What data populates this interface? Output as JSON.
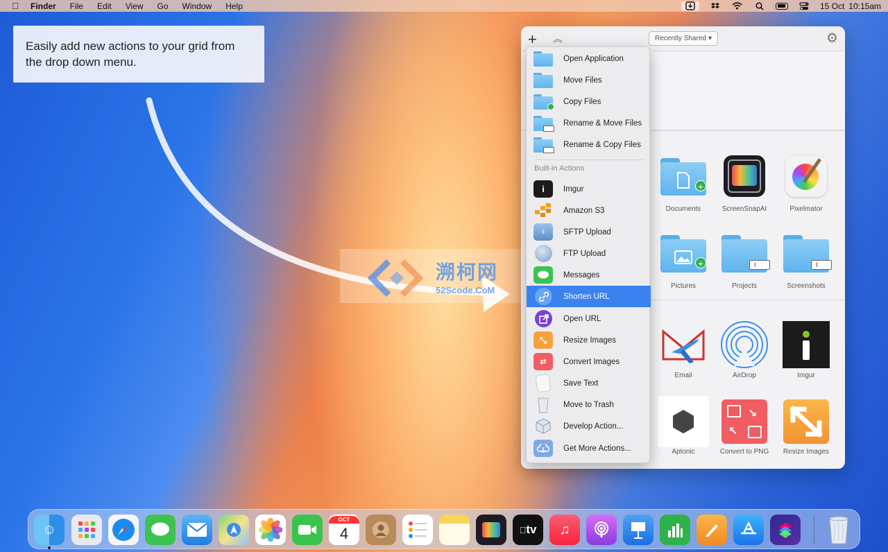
{
  "menubar": {
    "app_name": "Finder",
    "menus": [
      "File",
      "Edit",
      "View",
      "Go",
      "Window",
      "Help"
    ],
    "date": "15 Oct",
    "time": "10:15am"
  },
  "tip": {
    "text": "Easily add new actions to your grid from the drop down menu."
  },
  "watermark": {
    "title": "溯柯网",
    "subtitle": "52Scode.CoM"
  },
  "toolbar": {
    "add_symbol": "+",
    "collapse_symbol": "︽",
    "filter_selected": "Recently Shared",
    "gear_symbol": "⚙"
  },
  "grid": {
    "row1": [
      "Documents",
      "ScreenSnapAI",
      "Pixelmator"
    ],
    "row2": [
      "Pictures",
      "Projects",
      "Screenshots"
    ],
    "row3": [
      "Email",
      "AirDrop",
      "Imgur"
    ],
    "row4": [
      "Aptonic",
      "Convert to PNG",
      "Resize Images"
    ]
  },
  "menu": {
    "file_actions": [
      "Open Application",
      "Move Files",
      "Copy Files",
      "Rename & Move Files",
      "Rename & Copy Files"
    ],
    "builtin_header": "Built-in Actions",
    "builtin_actions": [
      "Imgur",
      "Amazon S3",
      "SFTP Upload",
      "FTP Upload",
      "Messages",
      "Shorten URL",
      "Open URL",
      "Resize Images",
      "Convert Images",
      "Save Text",
      "Move to Trash",
      "Develop Action...",
      "Get More Actions..."
    ],
    "highlighted": "Shorten URL"
  },
  "dock": {
    "calendar_month": "OCT",
    "calendar_day": "4",
    "tv_label": "tv"
  }
}
